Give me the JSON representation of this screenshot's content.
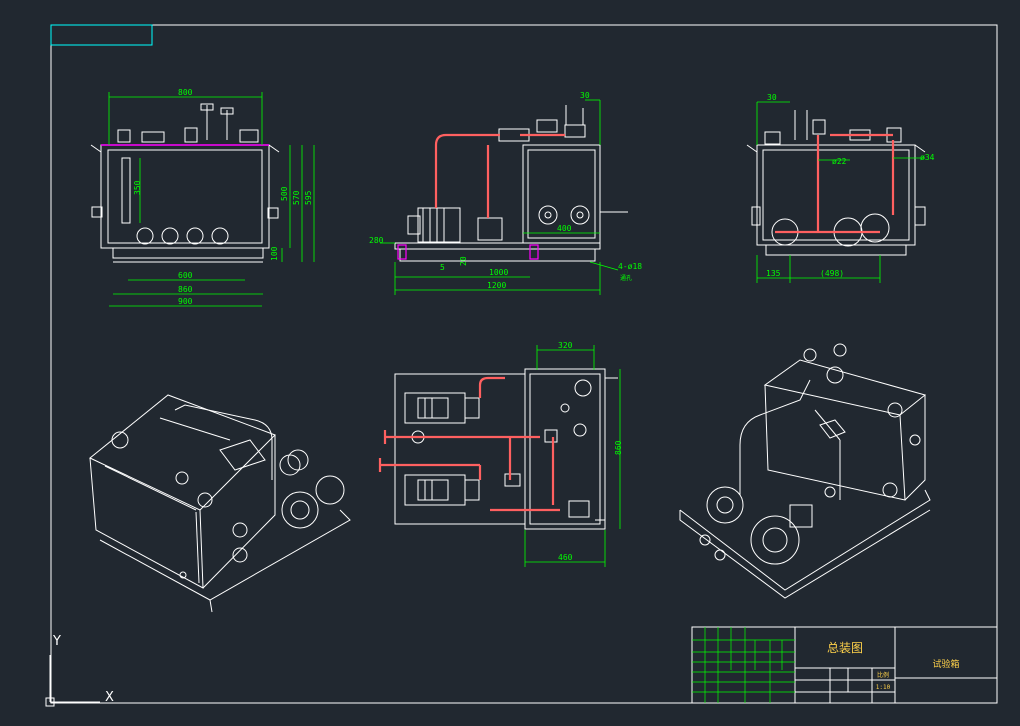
{
  "colors": {
    "background": "#212830",
    "geometry": "#ffffff",
    "dimension": "#00ff00",
    "pipe": "#ff5a5a",
    "border": "#ffffff",
    "marker": "#ff00ff",
    "title_text": "#ffd24a"
  },
  "front_view": {
    "dims": [
      "800",
      "350",
      "500",
      "570",
      "595",
      "100",
      "600",
      "860",
      "900"
    ]
  },
  "side_view": {
    "dims": [
      "30",
      "280",
      "400",
      "5",
      "20",
      "1000",
      "1200",
      "4-ø18"
    ],
    "note": "通孔"
  },
  "right_view": {
    "dims": [
      "30",
      "ø22",
      "ø34",
      "135",
      "(498)"
    ]
  },
  "top_view": {
    "dims": [
      "320",
      "860",
      "460"
    ]
  },
  "title_block": {
    "drawing_title": "总装图",
    "project_name": "试验箱",
    "scale_header": "比例",
    "scale": "1:10"
  },
  "ucs": {
    "y": "Y",
    "x": "X"
  }
}
